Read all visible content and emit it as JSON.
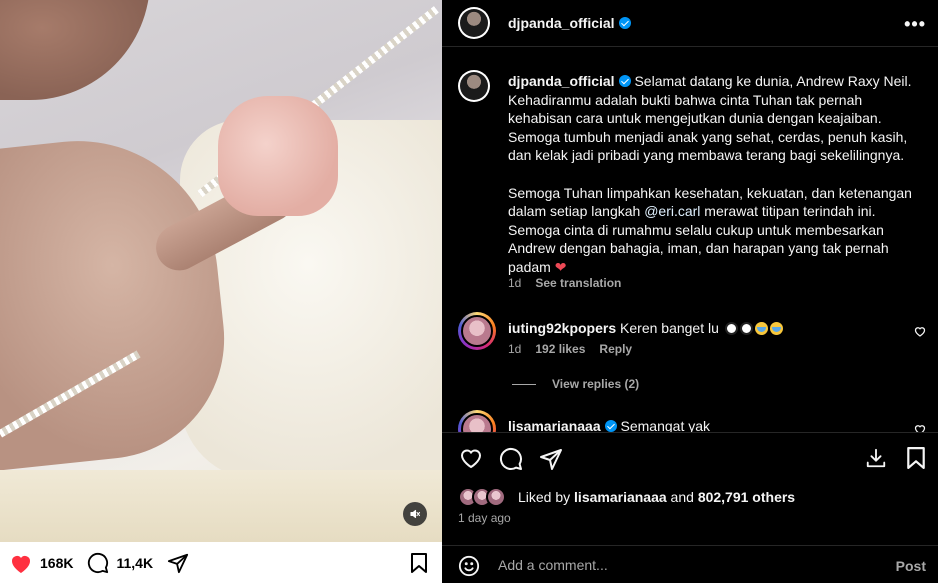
{
  "media": {
    "like_count": "168K",
    "comment_count": "11,4K"
  },
  "header": {
    "username": "djpanda_official"
  },
  "caption": {
    "username": "djpanda_official",
    "text_part1": " Selamat datang ke dunia, Andrew Raxy Neil. Kehadiranmu adalah bukti bahwa cinta Tuhan tak pernah kehabisan cara untuk mengejutkan dunia dengan keajaiban. Semoga tumbuh menjadi anak yang sehat, cerdas, penuh kasih, dan kelak jadi pribadi yang membawa terang bagi sekelilingnya.\n\nSemoga Tuhan limpahkan kesehatan, kekuatan, dan ketenangan dalam setiap langkah ",
    "mention": "@eri.carl",
    "text_part2": " merawat titipan terindah ini. Semoga cinta di rumahmu selalu cukup untuk membesarkan Andrew dengan bahagia, iman, dan harapan yang tak pernah padam ",
    "heart": "❤",
    "time": "1d",
    "see_translation": "See translation"
  },
  "comments": [
    {
      "username": "iuting92kpopers",
      "text": "Keren banget lu",
      "time": "1d",
      "likes": "192 likes",
      "reply": "Reply",
      "view_replies": "View replies (2)"
    },
    {
      "username": "lisamarianaaa",
      "text": "Semangat yak"
    }
  ],
  "likes": {
    "liked_by_prefix": "Liked by ",
    "liked_by_user": "lisamarianaaa",
    "and": " and ",
    "others": "802,791 others",
    "time": "1 day ago"
  },
  "add_comment": {
    "placeholder": "Add a comment...",
    "post_label": "Post"
  },
  "colors": {
    "verified": "#0095f6",
    "heart_red": "#ff3040",
    "secondary_text": "#a8a8a8"
  }
}
